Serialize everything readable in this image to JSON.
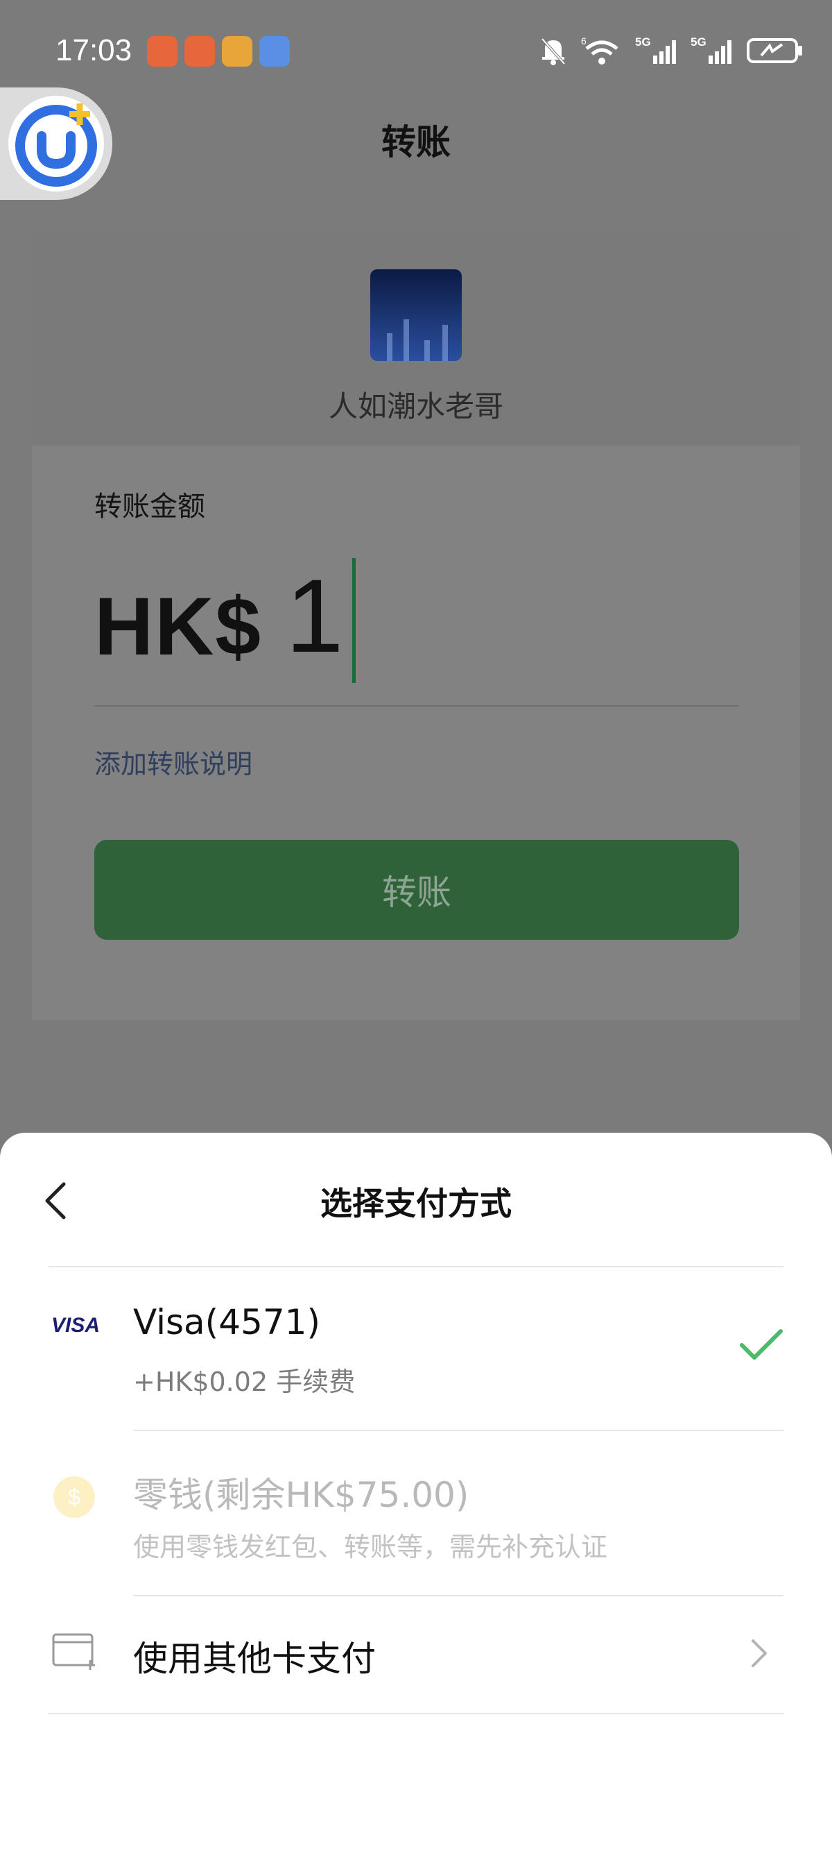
{
  "status_bar": {
    "time": "17:03",
    "network_labels": [
      "6",
      "5G",
      "5G"
    ]
  },
  "page": {
    "title": "转账",
    "recipient_name": "人如潮水老哥",
    "amount_label": "转账金额",
    "currency": "HK$",
    "amount": "1",
    "add_note": "添加转账说明",
    "transfer_button": "转账"
  },
  "sheet": {
    "title": "选择支付方式",
    "options": [
      {
        "icon": "visa-icon",
        "title": "Visa(4571)",
        "subtitle": "+HK$0.02 手续费",
        "selected": true
      },
      {
        "icon": "coin-icon",
        "title": "零钱(剩余HK$75.00)",
        "subtitle": "使用零钱发红包、转账等，需先补充认证",
        "disabled": true
      },
      {
        "icon": "add-card-icon",
        "title": "使用其他卡支付"
      }
    ],
    "visa_label": "VISA"
  },
  "colors": {
    "brand_green": "#07c160",
    "check_green": "#4cba6a",
    "visa_blue": "#1a1f71"
  }
}
